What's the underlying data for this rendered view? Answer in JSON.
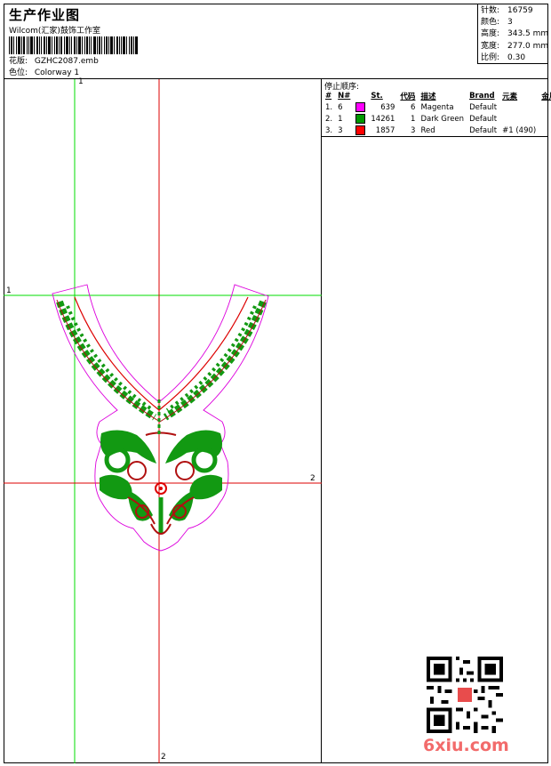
{
  "header": {
    "title": "生产作业图",
    "company": "Wilcom(汇家)鼓饰工作室",
    "design_label": "花版:",
    "design_value": "GZHC2087.emb",
    "colorway_label": "色位:",
    "colorway_value": "Colorway 1"
  },
  "stats": [
    {
      "label": "针数:",
      "value": "16759"
    },
    {
      "label": "颜色:",
      "value": "3"
    },
    {
      "label": "高度:",
      "value": "343.5 mm"
    },
    {
      "label": "宽度:",
      "value": "277.0 mm"
    },
    {
      "label": "比例:",
      "value": "0.30"
    }
  ],
  "stop_sequence": {
    "title": "停止顺序:",
    "columns": [
      "#",
      "N#",
      "St.",
      "代码",
      "描述",
      "Brand",
      "元素",
      "金片线"
    ],
    "rows": [
      {
        "idx": "1.",
        "n": "6",
        "color": "#ff00ff",
        "st": "639",
        "code": "6",
        "desc": "Magenta",
        "brand": "Default",
        "elem": "",
        "seq": ""
      },
      {
        "idx": "2.",
        "n": "1",
        "color": "#009900",
        "st": "14261",
        "code": "1",
        "desc": "Dark Green",
        "brand": "Default",
        "elem": "",
        "seq": ""
      },
      {
        "idx": "3.",
        "n": "3",
        "color": "#ff0000",
        "st": "1857",
        "code": "3",
        "desc": "Red",
        "brand": "Default",
        "elem": "#1 (490)",
        "seq": ""
      }
    ]
  },
  "axes": {
    "v1": "1",
    "h1": "1",
    "h2": "2",
    "v2": "2"
  },
  "watermark": "6xiu.com",
  "colors": {
    "green_guide": "#00dd00",
    "red_guide": "#dd0000",
    "outline": "#dd00dd",
    "fill": "#129912",
    "stitch": "#b01010"
  }
}
